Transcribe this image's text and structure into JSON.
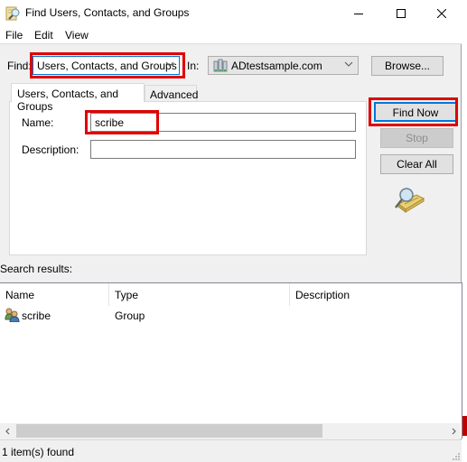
{
  "window": {
    "title": "Find Users, Contacts, and Groups",
    "controls": {
      "minimize": "minimize",
      "maximize": "maximize",
      "close": "close"
    }
  },
  "menu": [
    "File",
    "Edit",
    "View"
  ],
  "find": {
    "label": "Find:",
    "selected": "Users, Contacts, and Groups",
    "in_label": "In:",
    "in_selected": "ADtestsample.com",
    "browse_label": "Browse..."
  },
  "tabs": [
    {
      "label": "Users, Contacts, and Groups",
      "active": true
    },
    {
      "label": "Advanced",
      "active": false
    }
  ],
  "form": {
    "name_label": "Name:",
    "name_value": "scribe",
    "description_label": "Description:",
    "description_value": ""
  },
  "buttons": {
    "find_now": "Find Now",
    "stop": "Stop",
    "clear_all": "Clear All"
  },
  "results": {
    "label": "Search results:",
    "columns": [
      "Name",
      "Type",
      "Description"
    ],
    "rows": [
      {
        "name": "scribe",
        "type": "Group",
        "description": "",
        "icon": "group-icon"
      }
    ]
  },
  "status": "1 item(s) found",
  "highlight_color": "#e00000",
  "accent_color": "#0078d7"
}
